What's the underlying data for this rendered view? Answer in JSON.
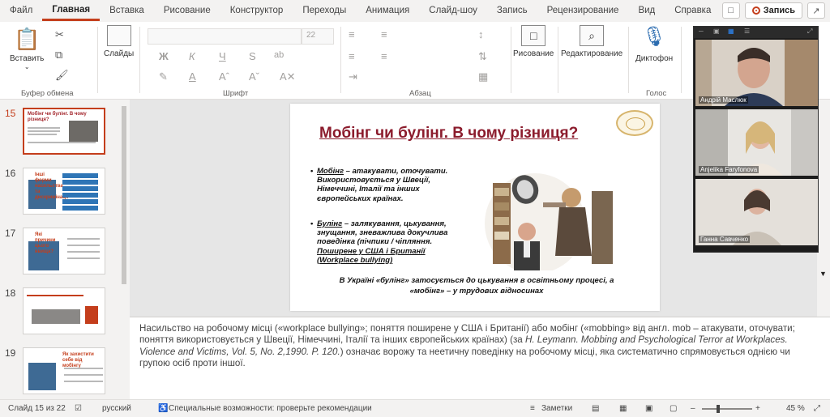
{
  "menu": {
    "items": [
      "Файл",
      "Главная",
      "Вставка",
      "Рисование",
      "Конструктор",
      "Переходы",
      "Анимация",
      "Слайд-шоу",
      "Запись",
      "Рецензирование",
      "Вид",
      "Справка"
    ],
    "active_index": 1,
    "record_label": "Запись"
  },
  "ribbon": {
    "paste_label": "Вставить",
    "clipboard_group": "Буфер обмена",
    "slides_label": "Слайды",
    "font_group": "Шрифт",
    "font_size": "22",
    "paragraph_group": "Абзац",
    "drawing_label": "Рисование",
    "editing_label": "Редактирование",
    "dictation_label": "Диктофон",
    "voice_group": "Голос",
    "format_buttons": [
      "Ж",
      "К",
      "Ч",
      "S",
      "ab",
      "A"
    ]
  },
  "thumbnails": [
    {
      "num": "15",
      "title": "Мобінг чи булінг. В чому різниця?",
      "active": true
    },
    {
      "num": "16",
      "title": "Інші форми насильства та дискримінації",
      "active": false
    },
    {
      "num": "17",
      "title": "Які причини цього явища?",
      "active": false
    },
    {
      "num": "18",
      "title": "",
      "active": false
    },
    {
      "num": "19",
      "title": "Як захистити себе від мобінгу",
      "active": false
    }
  ],
  "slide": {
    "title": "Мобінг чи булінг. В чому різниця?",
    "bullet1_line1": "Мобінг",
    "bullet1_line1_rest": " – атакувати, оточувати.",
    "bullet1_line2": "Використовується у Швеції,",
    "bullet1_line3": "Німеччині, Італії та інших",
    "bullet1_line4": "європейських країнах.",
    "bullet2_line1": "Булінг",
    "bullet2_line1_rest": " – залякування, цькування,",
    "bullet2_line2": "знущання, зневажлива докучлива",
    "bullet2_line3": "поведінка (пічпики / чіпляння.",
    "bullet2_line4": "Поширене у США і Британії",
    "bullet2_line5": "(Workplace bullying)",
    "footer_line1": "В Україні «булінг» затосується до цькування в освітньому процесі, а",
    "footer_line2": "«мобінг» – у трудових відносинах"
  },
  "notes": {
    "part1": "Насильство на робочому місці («workplace bullying»; поняття поширене у США і Британії) або мобінг («mobbing» від англ. mob – атакувати, оточувати; поняття використовується у Швеції, Німеччині, Італії та інших європейських країнах) (за ",
    "citation": "H. Leymann. Mobbing and Psychological Terror at Workplaces. Violence and Victims, Vol. 5, No. 2,1990.  P. 120.",
    "part2": ") означає ворожу та неетичну поведінку на робочому місці, яка систематично спрямовується однією чи групою осіб проти іншої."
  },
  "status": {
    "slide_counter": "Слайд 15 из 22",
    "language": "русский",
    "accessibility": "Специальные возможности: проверьте рекомендации",
    "notes_label": "Заметки",
    "zoom": "45 %"
  },
  "video": {
    "participants": [
      "Андрій Маслюк",
      "Anjelika Faryfonova",
      "Ганна Савченко"
    ]
  }
}
